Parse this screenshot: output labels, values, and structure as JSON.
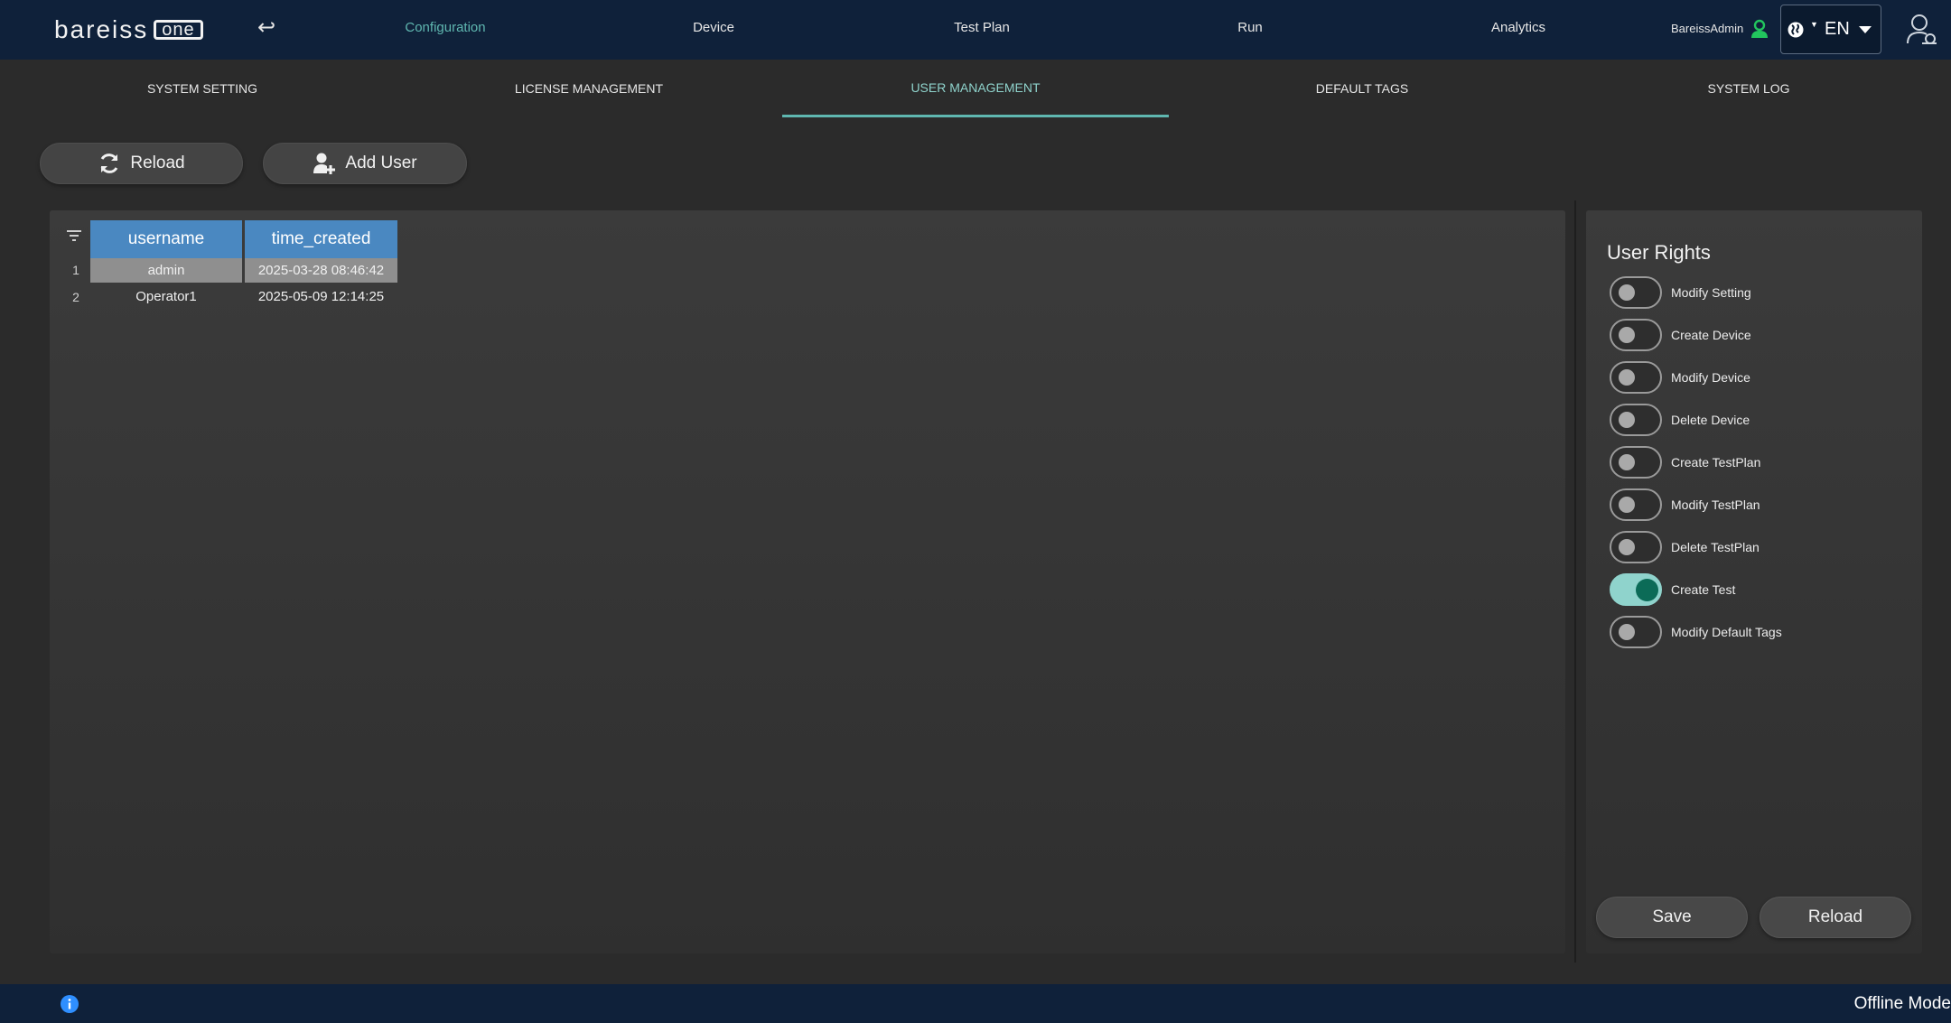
{
  "app": {
    "logo_text": "bareiss",
    "logo_badge": "one"
  },
  "nav": {
    "back_icon": "back-arrow-icon",
    "items": [
      {
        "label": "Configuration",
        "active": true
      },
      {
        "label": "Device",
        "active": false
      },
      {
        "label": "Test Plan",
        "active": false
      },
      {
        "label": "Run",
        "active": false
      },
      {
        "label": "Analytics",
        "active": false
      }
    ],
    "user_name": "BareissAdmin",
    "language": "EN"
  },
  "subtabs": [
    {
      "label": "SYSTEM SETTING",
      "active": false
    },
    {
      "label": "LICENSE MANAGEMENT",
      "active": false
    },
    {
      "label": "USER MANAGEMENT",
      "active": true
    },
    {
      "label": "DEFAULT TAGS",
      "active": false
    },
    {
      "label": "SYSTEM LOG",
      "active": false
    }
  ],
  "toolbar": {
    "reload_label": "Reload",
    "add_user_label": "Add User"
  },
  "table": {
    "columns": [
      "username",
      "time_created"
    ],
    "rows": [
      {
        "num": "1",
        "username": "admin",
        "time_created": "2025-03-28 08:46:42",
        "selected": true
      },
      {
        "num": "2",
        "username": "Operator1",
        "time_created": "2025-05-09 12:14:25",
        "selected": false
      }
    ]
  },
  "rights": {
    "title": "User Rights",
    "items": [
      {
        "label": "Modify Setting",
        "on": false
      },
      {
        "label": "Create Device",
        "on": false
      },
      {
        "label": "Modify Device",
        "on": false
      },
      {
        "label": "Delete Device",
        "on": false
      },
      {
        "label": "Create TestPlan",
        "on": false
      },
      {
        "label": "Modify TestPlan",
        "on": false
      },
      {
        "label": "Delete TestPlan",
        "on": false
      },
      {
        "label": "Create Test",
        "on": true
      },
      {
        "label": "Modify Default Tags",
        "on": false
      }
    ],
    "save_label": "Save",
    "reload_label": "Reload"
  },
  "status": {
    "mode": "Offline Mode"
  },
  "colors": {
    "nav_bg": "#0f213a",
    "accent": "#5fb7b0",
    "header_blue": "#4a88c1",
    "toggle_on": "#8fd3cc"
  }
}
